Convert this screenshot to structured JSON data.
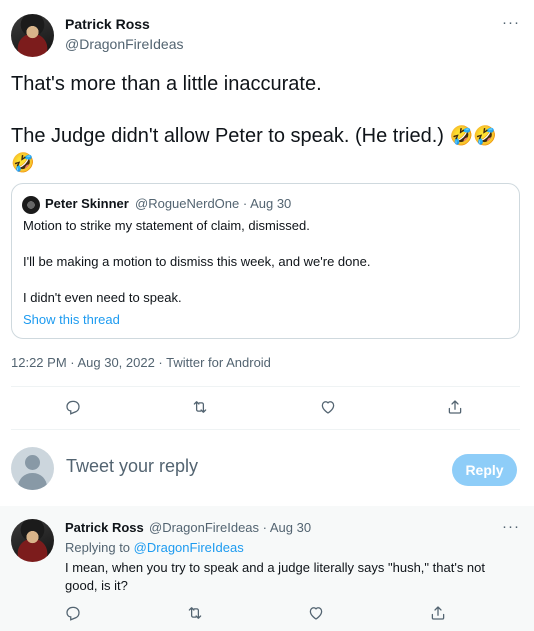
{
  "tweet": {
    "author_name": "Patrick Ross",
    "author_handle": "@DragonFireIdeas",
    "more_label": "···",
    "body_line1": "That's more than a little inaccurate.",
    "body_line2": "The Judge didn't allow Peter to speak. (He tried.)",
    "body_emoji_a": "🤣🤣",
    "body_emoji_b": "🤣",
    "timestamp": "12:22 PM · Aug 30, 2022 · Twitter for Android"
  },
  "quote": {
    "author_name": "Peter Skinner",
    "author_handle_date": "@RogueNerdOne · Aug 30",
    "line1": "Motion to strike my statement of claim, dismissed.",
    "line2": "I'll be making a motion to dismiss this week, and we're done.",
    "line3": "I didn't even need to speak.",
    "show_thread": "Show this thread"
  },
  "actions": [
    "reply-icon",
    "retweet-icon",
    "like-icon",
    "share-icon"
  ],
  "reply_box": {
    "placeholder": "Tweet your reply",
    "button_label": "Reply"
  },
  "reply": {
    "author_name": "Patrick Ross",
    "author_handle_date": "@DragonFireIdeas · Aug 30",
    "more_label": "···",
    "replying_prefix": "Replying to",
    "replying_handle": "@DragonFireIdeas",
    "text": "I mean, when you try to speak and a judge literally says \"hush,\" that's not good, is it?"
  },
  "colors": {
    "accent": "#1d9bf0",
    "muted": "#536471",
    "reply_button": "#8ecdf8",
    "reply_bg": "#f7f9f9"
  }
}
